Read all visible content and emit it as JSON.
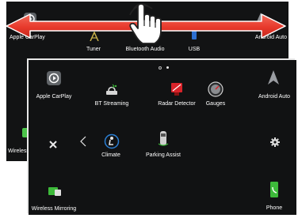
{
  "back_screen": {
    "sources": {
      "apple_carplay": "Apple CarPlay",
      "tuner": "Tuner",
      "bluetooth_audio": "Bluetooth Audio",
      "usb": "USB",
      "android_auto": "Android Auto",
      "wireless_mirroring": "Wireless M"
    }
  },
  "front_screen": {
    "page_indicator": {
      "pages": 2,
      "current": 2
    },
    "row1": {
      "apple_carplay": "Apple CarPlay",
      "bt_streaming": "BT Streaming",
      "radar_detector": "Radar Detector",
      "gauges": "Gauges",
      "android_auto": "Android Auto"
    },
    "row2": {
      "climate": "Climate",
      "parking_assist": "Parking Assist"
    },
    "row3": {
      "wireless_mirroring": "Wireless Mirroring",
      "phone": "Phone"
    }
  },
  "colors": {
    "swipe_arrow": "#e8392b",
    "hand_outline": "#222222",
    "front_bg": "#111213",
    "accent_green": "#3dba3a",
    "radar_red": "#d8232a"
  },
  "gesture": "swipe-left-right"
}
